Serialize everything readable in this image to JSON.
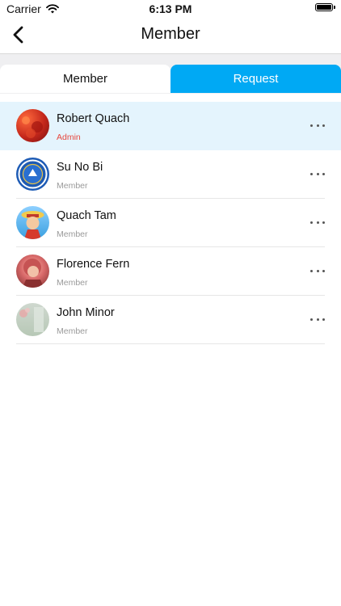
{
  "status_bar": {
    "carrier": "Carrier",
    "time": "6:13 PM"
  },
  "nav": {
    "title": "Member"
  },
  "tabs": [
    {
      "label": "Member",
      "active": false
    },
    {
      "label": "Request",
      "active": true
    }
  ],
  "members": [
    {
      "name": "Robert Quach",
      "role": "Admin",
      "selected": true
    },
    {
      "name": "Su No Bi",
      "role": "Member"
    },
    {
      "name": "Quach Tam",
      "role": "Member"
    },
    {
      "name": "Florence Fern",
      "role": "Member"
    },
    {
      "name": "John Minor",
      "role": "Member"
    }
  ],
  "colors": {
    "accent": "#00a9f4",
    "admin": "#e7483f",
    "selected_row": "#e4f4fd",
    "strip": "#efeff1"
  },
  "icons": {
    "back": "chevron-left-icon",
    "wifi": "wifi-icon",
    "battery": "battery-icon",
    "more": "ellipsis-icon"
  }
}
